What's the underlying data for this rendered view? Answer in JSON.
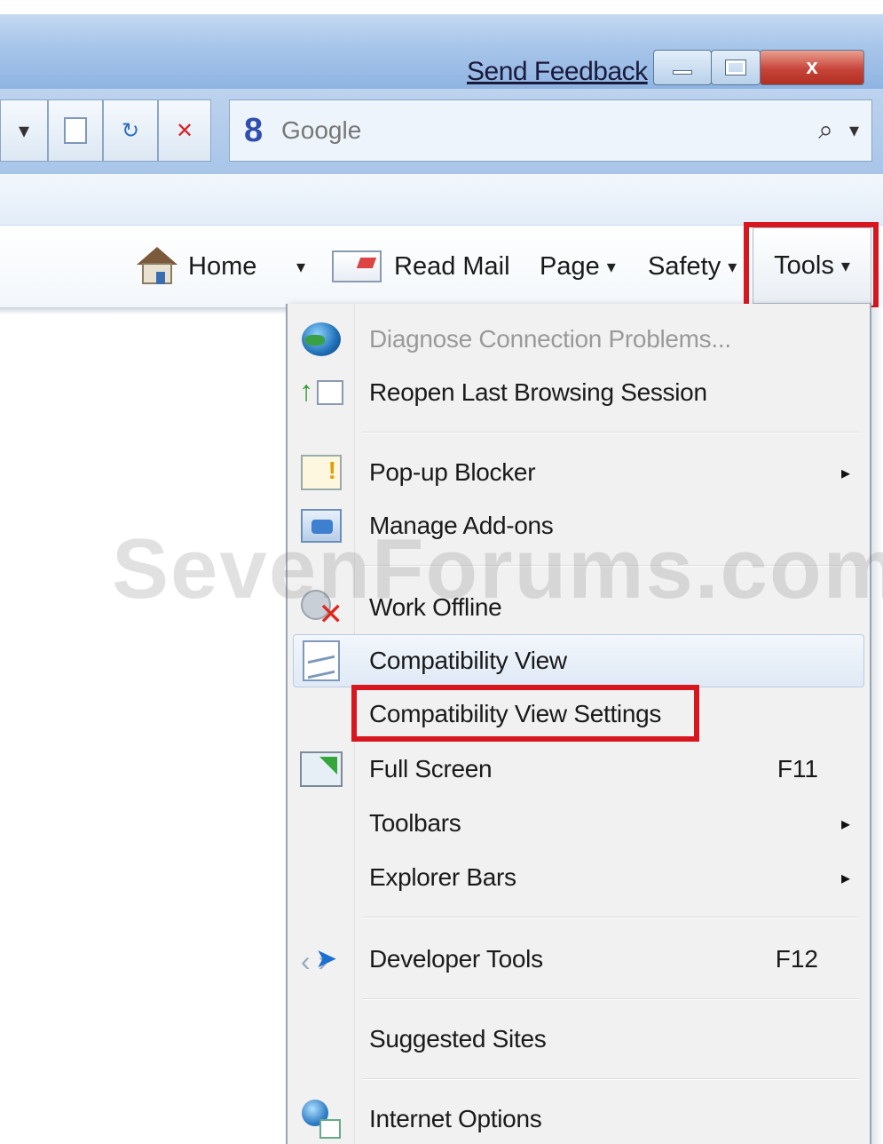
{
  "titlebar": {
    "send_feedback": "Send Feedback",
    "close_glyph": "x"
  },
  "toolbar": {
    "search_engine_icon": "8",
    "search_placeholder": "Google",
    "search_icon_glyph": "⌕",
    "stop_glyph": "✕",
    "refresh_glyph": "↻",
    "dropdown_glyph": "▾"
  },
  "command_bar": {
    "home": "Home",
    "read_mail": "Read Mail",
    "page": "Page",
    "safety": "Safety",
    "tools": "Tools",
    "caret": "▾"
  },
  "tools_menu": {
    "items": [
      {
        "label": "Diagnose Connection Problems...",
        "icon": "globe-icon",
        "disabled": true
      },
      {
        "label": "Reopen Last Browsing Session",
        "icon": "reopen-session-icon"
      },
      {
        "label": "Pop-up Blocker",
        "icon": "popup-blocker-icon",
        "submenu": true
      },
      {
        "label": "Manage Add-ons",
        "icon": "addons-icon"
      },
      {
        "label": "Work Offline",
        "icon": "work-offline-icon"
      },
      {
        "label": "Compatibility View",
        "icon": "compatibility-view-icon"
      },
      {
        "label": "Compatibility View Settings"
      },
      {
        "label": "Full Screen",
        "icon": "full-screen-icon",
        "shortcut": "F11"
      },
      {
        "label": "Toolbars",
        "submenu": true
      },
      {
        "label": "Explorer Bars",
        "submenu": true
      },
      {
        "label": "Developer Tools",
        "icon": "developer-tools-icon",
        "shortcut": "F12"
      },
      {
        "label": "Suggested Sites"
      },
      {
        "label": "Internet Options",
        "icon": "internet-options-icon"
      }
    ],
    "submenu_arrow": "▸"
  },
  "watermark": "SevenForums.com",
  "colors": {
    "highlight_red": "#d8161e",
    "titlebar_blue": "#a9c6ea",
    "menu_bg": "#f1f1f1"
  }
}
